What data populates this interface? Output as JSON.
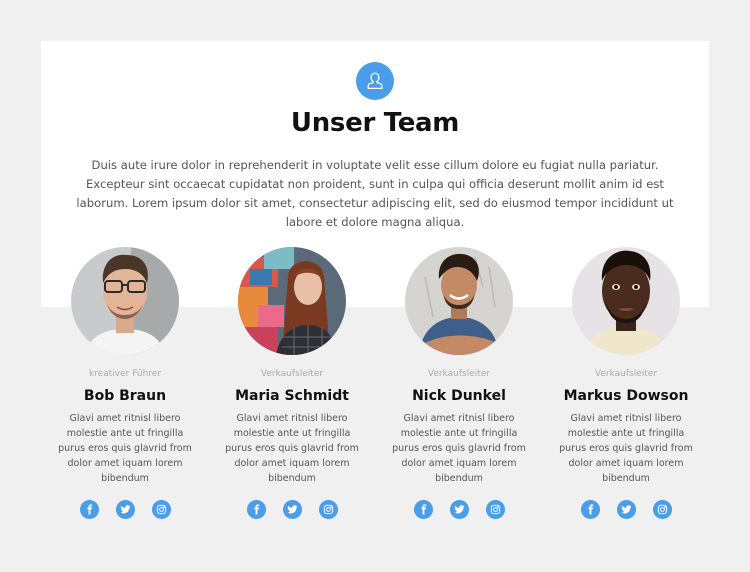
{
  "header": {
    "icon": "user-icon",
    "title": "Unser Team",
    "intro": "Duis aute irure dolor in reprehenderit in voluptate velit esse cillum dolore eu fugiat nulla pariatur. Excepteur sint occaecat cupidatat non proident, sunt in culpa qui officia deserunt mollit anim id est laborum. Lorem ipsum dolor sit amet, consectetur adipiscing elit, sed do eiusmod tempor incididunt ut labore et dolore magna aliqua."
  },
  "colors": {
    "accent": "#4a9de8",
    "background": "#f0f0f0",
    "panel": "#ffffff",
    "heading": "#111111",
    "body_text": "#555555",
    "role_text": "#aaaaaa"
  },
  "members": [
    {
      "role": "kreativer Führer",
      "name": "Bob Braun",
      "bio": "Glavi amet ritnisl libero molestie ante ut fringilla purus eros quis glavrid from dolor amet iquam lorem bibendum",
      "photo": "man with glasses, light grey background",
      "socials": [
        "facebook-icon",
        "twitter-icon",
        "instagram-icon"
      ]
    },
    {
      "role": "Verkaufsleiter",
      "name": "Maria Schmidt",
      "bio": "Glavi amet ritnisl libero molestie ante ut fringilla purus eros quis glavrid from dolor amet iquam lorem bibendum",
      "photo": "woman with long red hair, colorful graffiti background",
      "socials": [
        "facebook-icon",
        "twitter-icon",
        "instagram-icon"
      ]
    },
    {
      "role": "Verkaufsleiter",
      "name": "Nick Dunkel",
      "bio": "Glavi amet ritnisl libero molestie ante ut fringilla purus eros quis glavrid from dolor amet iquam lorem bibendum",
      "photo": "smiling man in blue t-shirt, arms crossed, concrete wall",
      "socials": [
        "facebook-icon",
        "twitter-icon",
        "instagram-icon"
      ]
    },
    {
      "role": "Verkaufsleiter",
      "name": "Markus Dowson",
      "bio": "Glavi amet ritnisl libero molestie ante ut fringilla purus eros quis glavrid from dolor amet iquam lorem bibendum",
      "photo": "man with beard, cream shirt, light background",
      "socials": [
        "facebook-icon",
        "twitter-icon",
        "instagram-icon"
      ]
    }
  ]
}
